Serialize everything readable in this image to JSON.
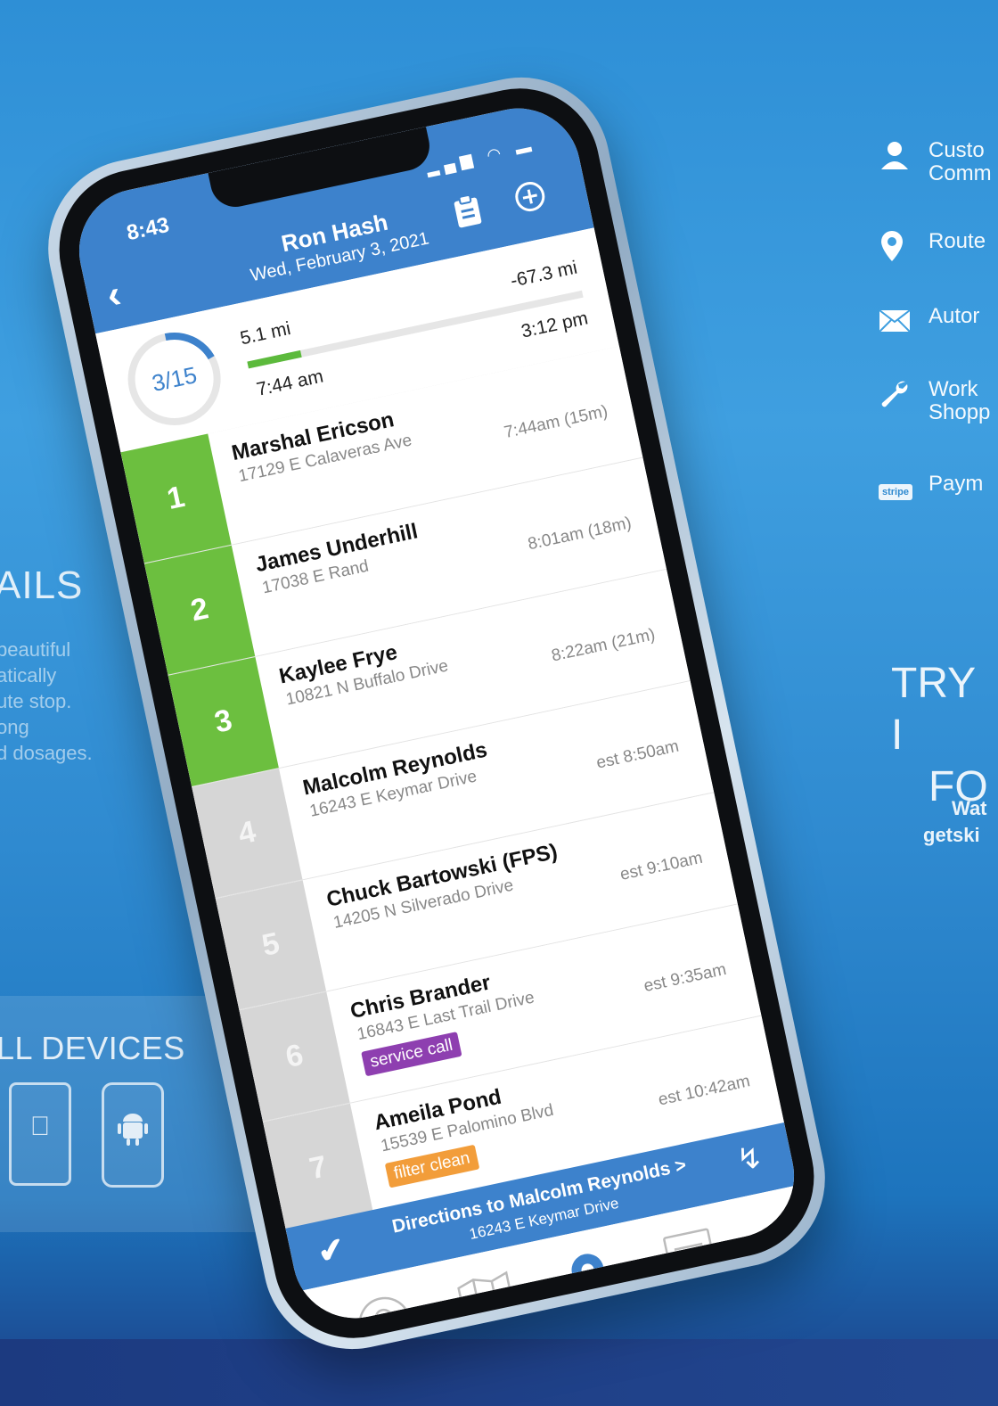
{
  "marketing": {
    "left_heading": "AILS",
    "left_lines": [
      "beautiful",
      "atically",
      "ute stop.",
      "ong",
      "d dosages."
    ],
    "devices_heading": "LL DEVICES",
    "features": [
      {
        "icon": "person-icon",
        "lines": [
          "Custo",
          "Comm"
        ]
      },
      {
        "icon": "map-pin-icon",
        "lines": [
          "Route"
        ]
      },
      {
        "icon": "envelope-icon",
        "lines": [
          "Autor"
        ]
      },
      {
        "icon": "wrench-icon",
        "lines": [
          "Work",
          "Shopp"
        ]
      },
      {
        "icon": "stripe-icon",
        "badge": "stripe",
        "lines": [
          "Paym"
        ]
      }
    ],
    "try_lines": [
      "TRY I",
      "FO"
    ],
    "try_sub": [
      "Wat",
      "getski"
    ]
  },
  "phone": {
    "status": {
      "time": "8:43",
      "icons": "signal-icon wifi-icon battery-icon"
    },
    "header": {
      "title": "Ron Hash",
      "date": "Wed, February 3, 2021",
      "accent": "#3d82cc"
    },
    "summary": {
      "progress_label": "3/15",
      "completed": 3,
      "total": 15,
      "distance_done": "5.1 mi",
      "distance_remaining": "-67.3 mi",
      "start_time": "7:44 am",
      "end_time": "3:12 pm",
      "track_progress": 0.16
    },
    "stops": [
      {
        "num": "1",
        "name": "Marshal Ericson",
        "addr": "17129 E Calaveras Ave",
        "eta": "7:44am (15m)",
        "status": "done"
      },
      {
        "num": "2",
        "name": "James Underhill",
        "addr": "17038 E Rand",
        "eta": "8:01am (18m)",
        "status": "done"
      },
      {
        "num": "3",
        "name": "Kaylee Frye",
        "addr": "10821 N Buffalo Drive",
        "eta": "8:22am (21m)",
        "status": "done"
      },
      {
        "num": "4",
        "name": "Malcolm Reynolds",
        "addr": "16243 E Keymar Drive",
        "eta": "est 8:50am",
        "status": "todo"
      },
      {
        "num": "5",
        "name": "Chuck Bartowski (FPS)",
        "addr": "14205 N Silverado Drive",
        "eta": "est 9:10am",
        "status": "todo"
      },
      {
        "num": "6",
        "name": "Chris Brander",
        "addr": "16843 E Last Trail Drive",
        "eta": "est 9:35am",
        "status": "todo",
        "tag": "service call",
        "tag_color": "purple"
      },
      {
        "num": "7",
        "name": "Ameila Pond",
        "addr": "15539 E Palomino Blvd",
        "eta": "est 10:42am",
        "status": "todo",
        "tag": "filter clean",
        "tag_color": "orange"
      }
    ],
    "directions": {
      "title": "Directions to Malcolm Reynolds >",
      "addr": "16243 E Keymar Drive"
    },
    "tabs": [
      "customers-tab",
      "map-tab",
      "route-tab",
      "list-tab",
      "settings-tab"
    ],
    "colors": {
      "done": "#6cbf3f",
      "todo": "#d6d6d6",
      "service": "#8e3fb0",
      "filter": "#f29d3a"
    }
  }
}
